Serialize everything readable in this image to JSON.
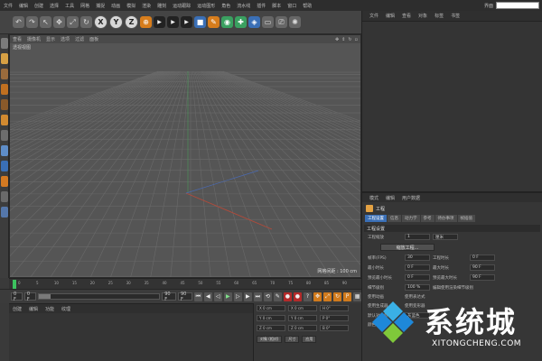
{
  "menubar": {
    "items": [
      "文件",
      "编辑",
      "创建",
      "选择",
      "工具",
      "网格",
      "捕捉",
      "动画",
      "模拟",
      "渲染",
      "雕刻",
      "运动跟踪",
      "运动图形",
      "角色",
      "流水线",
      "插件",
      "脚本",
      "窗口",
      "帮助"
    ],
    "layout_label": "界面"
  },
  "toolbar": {
    "axis_buttons": [
      "X",
      "Y",
      "Z"
    ]
  },
  "object_panel": {
    "tabs": [
      "文件",
      "编辑",
      "查看",
      "对象",
      "标签",
      "书签"
    ]
  },
  "viewport": {
    "menu": [
      "查看",
      "摄像机",
      "显示",
      "选项",
      "过滤",
      "面板"
    ],
    "camera_label": "透视视图",
    "grid_info": "网格间距 : 100 cm"
  },
  "timeline": {
    "ticks": [
      "0",
      "5",
      "10",
      "15",
      "20",
      "25",
      "30",
      "35",
      "40",
      "45",
      "50",
      "55",
      "60",
      "65",
      "70",
      "75",
      "80",
      "85",
      "90"
    ],
    "end_label": "0 F"
  },
  "transport": {
    "start_field": "0 F",
    "current_field": "0 F",
    "end_field": "90 F",
    "max_field": "90 F",
    "slider_fraction": 0.1
  },
  "material_panel": {
    "tabs": [
      "创建",
      "编辑",
      "功能",
      "纹理"
    ]
  },
  "coord_panel": {
    "rows": [
      [
        "X  0 cm",
        "X  0 cm",
        "H  0°"
      ],
      [
        "Y  0 cm",
        "Y  0 cm",
        "P  0°"
      ],
      [
        "Z  0 cm",
        "Z  0 cm",
        "B  0°"
      ]
    ],
    "buttons": [
      "对象 (相对)",
      "尺寸",
      "应用"
    ]
  },
  "attr_panel": {
    "tabs": [
      "模式",
      "编辑",
      "用户数据"
    ],
    "object_name": "工程",
    "subtabs": [
      "工程设置",
      "信息",
      "动力学",
      "参考",
      "待办事项",
      "帧插值"
    ],
    "section_title": "工程设置",
    "scale_label": "工程缩放",
    "scale_value": "1",
    "scale_unit": "厘米",
    "scale_button": "缩放工程...",
    "rows": [
      [
        "帧率(FPS)",
        "30",
        "工程时长",
        "0 F"
      ],
      [
        "最小时长",
        "0 F",
        "最大时长",
        "90 F"
      ],
      [
        "预览最小时长",
        "0 F",
        "预览最大时长",
        "90 F"
      ]
    ],
    "lod_label": "细节级别",
    "lod_value": "100 %",
    "lod_check_label": "编辑使用渲染细节级别",
    "use_anim": "使用动画",
    "use_expr": "使用表达式",
    "use_gen": "使用生成器",
    "use_deform": "使用变形器",
    "default_color_label": "默认对象颜色",
    "default_color_value": "灰蓝色",
    "color_label": "颜色"
  },
  "watermark": {
    "title": "系统城",
    "url": "XITONGCHENG.COM"
  },
  "colors": {
    "bg": "#3a3a3a",
    "viewport": "#555555",
    "accent_blue": "#3a6fb6",
    "playhead_green": "#3cc35f",
    "watermark_blue": "#1e88d9"
  }
}
